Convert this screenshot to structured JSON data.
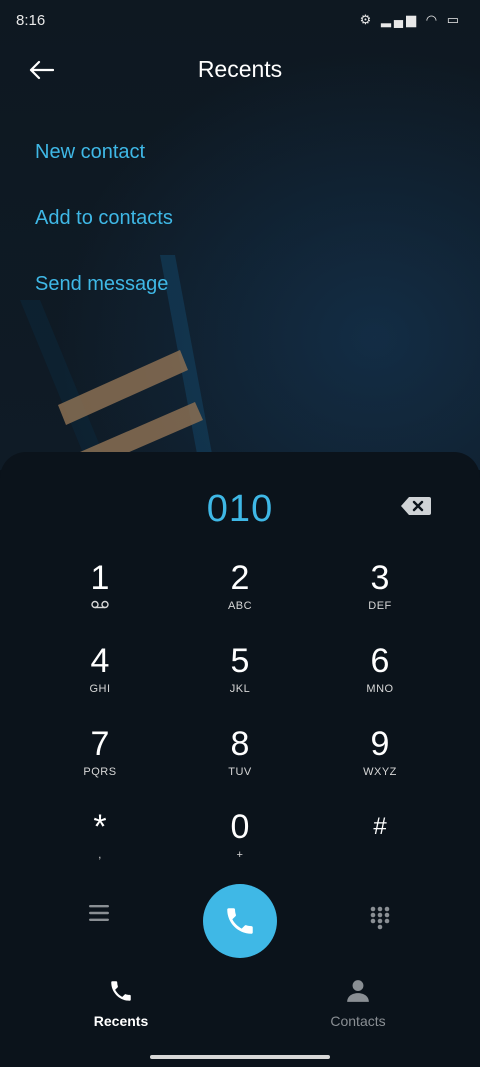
{
  "status_bar": {
    "time": "8:16",
    "icons": "⚙ ▂▄▆ ◠ ▭"
  },
  "header": {
    "title": "Recents"
  },
  "actions": [
    {
      "label": "New contact"
    },
    {
      "label": "Add to contacts"
    },
    {
      "label": "Send message"
    }
  ],
  "dialer": {
    "number": "010",
    "keys": [
      {
        "digit": "1",
        "letters": ""
      },
      {
        "digit": "2",
        "letters": "ABC"
      },
      {
        "digit": "3",
        "letters": "DEF"
      },
      {
        "digit": "4",
        "letters": "GHI"
      },
      {
        "digit": "5",
        "letters": "JKL"
      },
      {
        "digit": "6",
        "letters": "MNO"
      },
      {
        "digit": "7",
        "letters": "PQRS"
      },
      {
        "digit": "8",
        "letters": "TUV"
      },
      {
        "digit": "9",
        "letters": "WXYZ"
      },
      {
        "digit": "*",
        "letters": ","
      },
      {
        "digit": "0",
        "letters": "+"
      },
      {
        "digit": "#",
        "letters": ""
      }
    ]
  },
  "tabs": [
    {
      "label": "Recents"
    },
    {
      "label": "Contacts"
    }
  ],
  "colors": {
    "accent": "#3fb8e6",
    "background": "#0b131b",
    "inactive": "#8a8f94"
  }
}
